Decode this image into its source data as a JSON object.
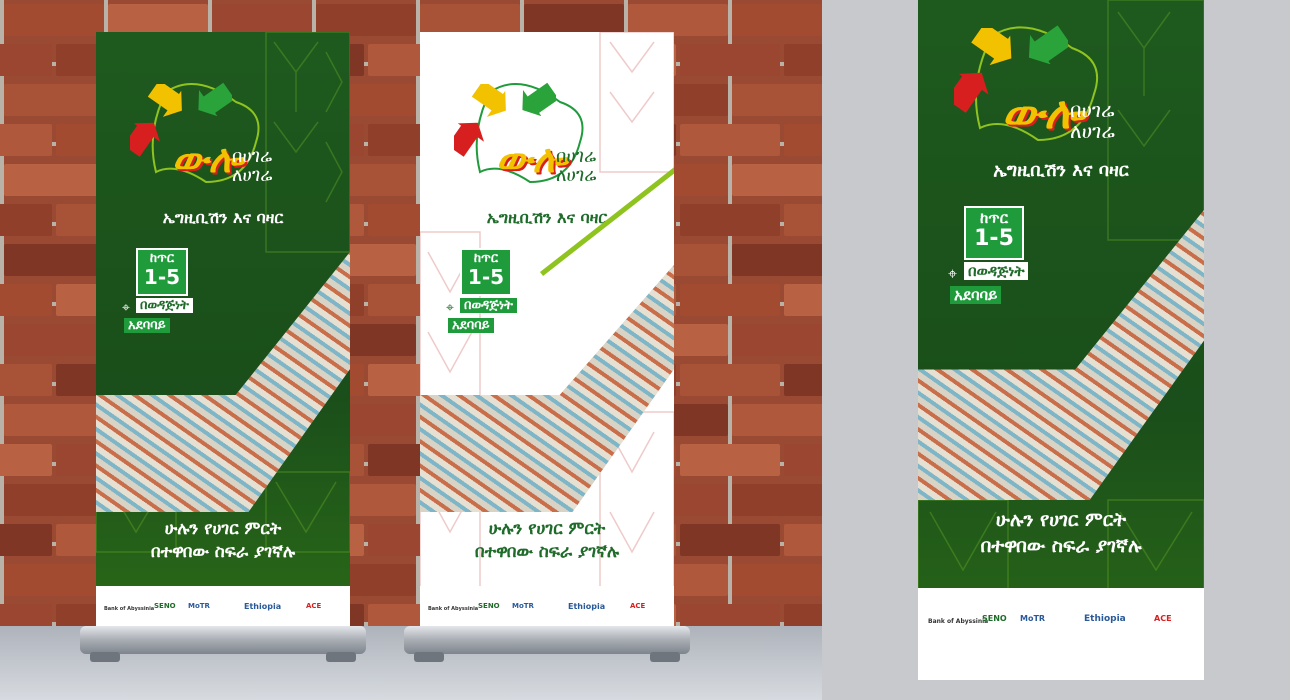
{
  "banner": {
    "logo_word": "ውሎ",
    "logo_line1": "በሀገሬ",
    "logo_line2": "ለሀገሬ",
    "subtitle": "ኤግዚቢሽን እና ባዛር",
    "month": "ከጥር",
    "days": "1-5",
    "venue_line1": "በወዳጅነት",
    "venue_line2": "አደባባይ",
    "tagline_line1": "ሁሉን የሀገር ምርት",
    "tagline_line2": "በተዋበው ስፍራ ያገኛሉ",
    "sponsors": [
      "Bank of Abyssinia",
      "SENO",
      "MoTR",
      "Ethiopia",
      "ACE"
    ],
    "sponsor_logo_text": "Ethiopia"
  },
  "colors": {
    "dark_green": "#1e5a1e",
    "bright_green": "#1f9b3c",
    "yellow": "#f2c200",
    "red": "#d81f1f",
    "lime": "#8fc31f"
  },
  "icons": [
    "map-pin-icon",
    "yellow-arrow-icon",
    "green-arrow-icon",
    "red-arrow-icon"
  ]
}
